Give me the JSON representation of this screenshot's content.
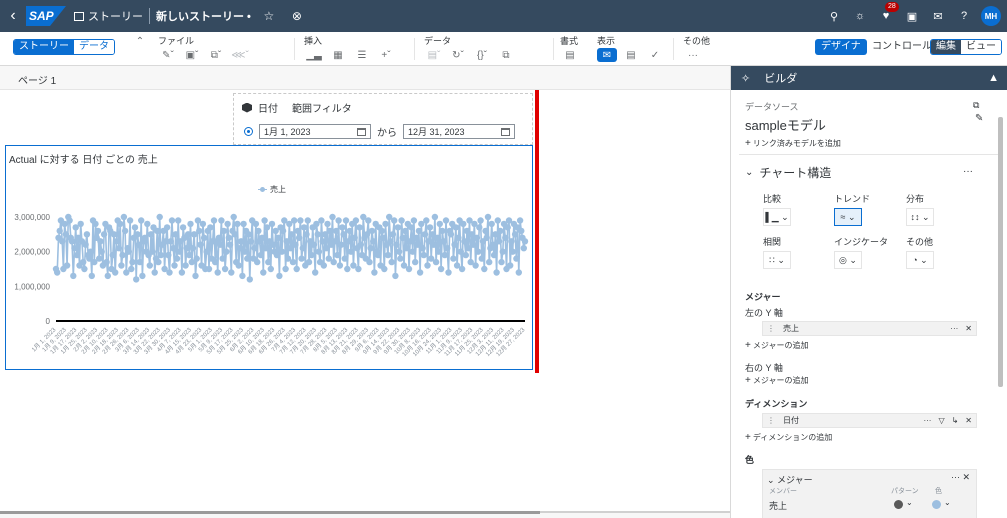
{
  "shell": {
    "back_icon": "chevron-left-icon",
    "logo": "SAP",
    "app_name": "ストーリー",
    "story_title": "新しいストーリー •",
    "notification_count": "28",
    "user_initials": "MH",
    "icons": [
      "search-icon",
      "lightbulb-icon",
      "bell-icon",
      "chat-icon",
      "feedback-icon",
      "help-icon"
    ]
  },
  "toolbar": {
    "view_toggle": [
      "ストーリー",
      "データ"
    ],
    "groups": {
      "file": "ファイル",
      "insert": "挿入",
      "data": "データ",
      "format": "書式",
      "display": "表示",
      "other": "その他"
    },
    "mode": {
      "designer": "デザイナ",
      "control": "コントロール",
      "edit": "編集",
      "view": "ビュー"
    }
  },
  "pages": {
    "active_tab": "ページ 1"
  },
  "filter": {
    "field": "日付",
    "type": "範囲フィルタ",
    "from": "1月 1, 2023",
    "connector": "から",
    "to": "12月 31, 2023"
  },
  "chart_data": {
    "type": "line",
    "title": "Actual に対する 日付  ごとの 売上",
    "legend": "売上",
    "series_color": "#9dbfe0",
    "ylim": [
      0,
      3000000
    ],
    "yticks": [
      "3,000,000",
      "2,000,000",
      "1,000,000",
      "0"
    ],
    "x_tick_labels": [
      "1月 1, 2023",
      "1月 9, 2023",
      "1月 17, 2023",
      "1月 25, 2023",
      "2月 2, 2023",
      "2月 10, 2023",
      "2月 18, 2023",
      "2月 26, 2023",
      "3月 6, 2023",
      "3月 14, 2023",
      "3月 22, 2023",
      "3月 30, 2023",
      "4月 7, 2023",
      "4月 15, 2023",
      "4月 23, 2023",
      "5月 1, 2023",
      "5月 9, 2023",
      "5月 17, 2023",
      "5月 25, 2023",
      "6月 2, 2023",
      "6月 10, 2023",
      "6月 18, 2023",
      "6月 26, 2023",
      "7月 4, 2023",
      "7月 12, 2023",
      "7月 20, 2023",
      "7月 28, 2023",
      "8月 5, 2023",
      "8月 13, 2023",
      "8月 21, 2023",
      "8月 29, 2023",
      "9月 6, 2023",
      "9月 14, 2023",
      "9月 22, 2023",
      "9月 30, 2023",
      "10月 8, 2023",
      "10月 16, 2023",
      "10月 24, 2023",
      "11月 1, 2023",
      "11月 9, 2023",
      "11月 17, 2023",
      "11月 25, 2023",
      "12月 3, 2023",
      "12月 11, 2023",
      "12月 19, 2023",
      "12月 27, 2023"
    ],
    "values": [
      1500000,
      1400000,
      2400000,
      2600000,
      2900000,
      2300000,
      1500000,
      2800000,
      2500000,
      1600000,
      3000000,
      2900000,
      2400000,
      2300000,
      1300000,
      2100000,
      2700000,
      1900000,
      2400000,
      1600000,
      2800000,
      2300000,
      1700000,
      1500000,
      2200000,
      2500000,
      1900000,
      1800000,
      2000000,
      1300000,
      2900000,
      1700000,
      2800000,
      2400000,
      2600000,
      1800000,
      2300000,
      2000000,
      1600000,
      2500000,
      2800000,
      1700000,
      1300000,
      2700000,
      2600000,
      1500000,
      1900000,
      2500000,
      1400000,
      2300000,
      2900000,
      2100000,
      2800000,
      1600000,
      1900000,
      3000000,
      2600000,
      1400000,
      2100000,
      2000000,
      2900000,
      1500000,
      1700000,
      2400000,
      2700000,
      1200000,
      2500000,
      2200000,
      1700000,
      2900000,
      1300000,
      2300000,
      2400000,
      2000000,
      2800000,
      1900000,
      1600000,
      2500000,
      2000000,
      2700000,
      1400000,
      1800000,
      2600000,
      1700000,
      3000000,
      1900000,
      2200000,
      2600000,
      1500000,
      2300000,
      2700000,
      1900000,
      1400000,
      2300000,
      2900000,
      2100000,
      1600000,
      2500000,
      1800000,
      2900000,
      2000000,
      2300000,
      1400000,
      2700000,
      2400000,
      1600000,
      2100000,
      2500000,
      1900000,
      2800000,
      1700000,
      2100000,
      2500000,
      1300000,
      1800000,
      2900000,
      2600000,
      2200000,
      1600000,
      2800000,
      2400000,
      1500000,
      2000000,
      2600000,
      1500000,
      2700000,
      1800000,
      2300000,
      2900000,
      1700000,
      2300000,
      1400000,
      2400000,
      2200000,
      2900000,
      1800000,
      2600000,
      1500000,
      2000000,
      2800000,
      2400000,
      2200000,
      1400000,
      2600000,
      3000000,
      2500000,
      1700000,
      2800000,
      1600000,
      2100000,
      2300000,
      1300000,
      2800000,
      2000000,
      2600000,
      1800000,
      2500000,
      1200000,
      2300000,
      2900000,
      1800000,
      2100000,
      2800000,
      1700000,
      2600000,
      2300000,
      1900000,
      2400000,
      1400000,
      2900000,
      2100000,
      2700000,
      1700000,
      2300000,
      1500000,
      2800000,
      2200000,
      2000000,
      2600000,
      1900000,
      2400000,
      1300000,
      2700000,
      2000000,
      2600000,
      2900000,
      1500000,
      2300000,
      1800000,
      2800000,
      2100000,
      2500000,
      1700000,
      2900000,
      2200000,
      1500000,
      2600000,
      2400000,
      2900000,
      1800000,
      2100000,
      2700000,
      1600000,
      2500000,
      2900000,
      1700000,
      2300000,
      1900000,
      2700000,
      2200000,
      1400000,
      2800000,
      2500000,
      2000000,
      1700000,
      2900000,
      2300000,
      1600000,
      2500000,
      2100000,
      2800000,
      1800000,
      2600000,
      2200000,
      3000000,
      1700000,
      2300000,
      2600000,
      1900000,
      2900000,
      1600000,
      2200000,
      2700000,
      2500000,
      1800000,
      2900000,
      1500000,
      2300000,
      2600000,
      2000000,
      2800000,
      1600000,
      2400000,
      2900000,
      2100000,
      1500000,
      2700000,
      2200000,
      1900000,
      3000000,
      2400000,
      1800000,
      2500000,
      2900000,
      1700000,
      2100000,
      2600000,
      2300000,
      1400000,
      2800000,
      2000000,
      1900000,
      2700000,
      1600000,
      2600000,
      2400000,
      1500000,
      2800000,
      2200000,
      1900000,
      3000000,
      2300000,
      1700000,
      2500000,
      2900000,
      1300000,
      2200000,
      2700000,
      2000000,
      1800000,
      2900000,
      2400000,
      1600000,
      2600000,
      2100000,
      2800000,
      1500000,
      2300000,
      2700000,
      2000000,
      2900000,
      1700000,
      2400000,
      2200000,
      2600000,
      1400000,
      2800000,
      2100000,
      1900000,
      2500000,
      2900000,
      1600000,
      2300000,
      2700000,
      1800000,
      2500000,
      2200000,
      3000000,
      1700000,
      2400000,
      2000000,
      2800000,
      1500000,
      2600000,
      2300000,
      1900000,
      2900000,
      2100000,
      1400000,
      2600000,
      2500000,
      2800000,
      1800000,
      2200000,
      2700000,
      1600000,
      2400000,
      2900000,
      2000000,
      1500000,
      2800000,
      2300000,
      1900000,
      2600000,
      2100000,
      2900000,
      1700000,
      2500000,
      2200000,
      2800000,
      1600000,
      2400000,
      2000000,
      2700000,
      2900000,
      1800000,
      2300000,
      1500000,
      2600000,
      2400000,
      3000000,
      1700000,
      2100000,
      2800000,
      2200000,
      1900000,
      2500000,
      1400000,
      2900000,
      2300000,
      2600000,
      1700000,
      2000000,
      2800000,
      2400000,
      1500000,
      2700000,
      2900000,
      1600000,
      2300000,
      2000000,
      2800000,
      2500000,
      1800000,
      2700000,
      1400000,
      2900000,
      2600000,
      2400000,
      2100000,
      2300000
    ]
  },
  "builder": {
    "title": "ビルダ",
    "datasource_label": "データソース",
    "datasource_name": "sampleモデル",
    "add_linked_model": "リンク済みモデルを追加",
    "chart_structure": "チャート構造",
    "chart_types": [
      {
        "label": "比較",
        "icon": "bar-chart-icon",
        "selected": false
      },
      {
        "label": "トレンド",
        "icon": "trend-chart-icon",
        "selected": true
      },
      {
        "label": "分布",
        "icon": "distribution-chart-icon",
        "selected": false
      },
      {
        "label": "相関",
        "icon": "scatter-chart-icon",
        "selected": false
      },
      {
        "label": "インジケータ",
        "icon": "target-icon",
        "selected": false
      },
      {
        "label": "その他",
        "icon": "pie-chart-icon",
        "selected": false
      }
    ],
    "measures_heading": "メジャー",
    "left_axis": "左の Y 軸",
    "left_measure": "売上",
    "add_measure": "メジャーの追加",
    "right_axis": "右の Y 軸",
    "add_measure_right": "メジャーの追加",
    "dimensions_heading": "ディメンション",
    "dimension": "日付",
    "add_dimension": "ディメンションの追加",
    "color_heading": "色",
    "color_box_title": "メジャー",
    "color_col_member": "メンバー",
    "color_col_pattern": "パターン",
    "color_col_color": "色",
    "color_member": "売上",
    "pattern_color": "#5a5a5a",
    "member_color": "#9dbfe0"
  }
}
